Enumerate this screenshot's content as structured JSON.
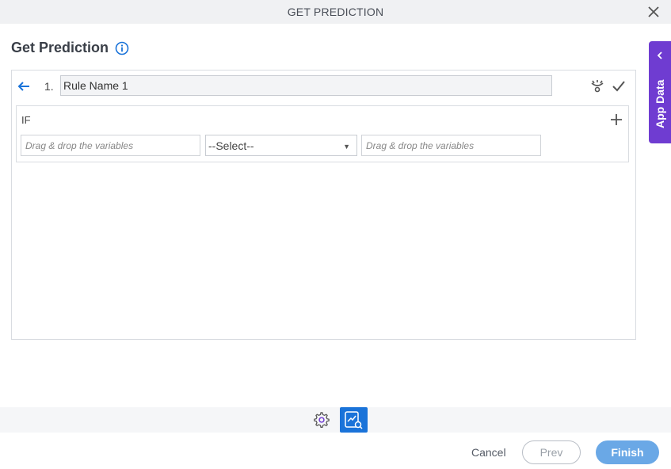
{
  "window": {
    "title": "GET PREDICTION",
    "close_icon": "close-icon"
  },
  "page": {
    "heading": "Get Prediction",
    "info_icon": "info-icon"
  },
  "rule": {
    "number": "1.",
    "name_value": "Rule Name 1",
    "icons": [
      "back-arrow-icon",
      "eye-toggle-icon",
      "check-icon"
    ]
  },
  "condition": {
    "label": "IF",
    "left_placeholder": "Drag & drop the variables",
    "operator_selected": "--Select--",
    "right_placeholder": "Drag & drop the variables",
    "add_icon": "plus-icon"
  },
  "side_panel": {
    "label": "App Data",
    "icon": "chevron-left-icon",
    "color": "#6f3cd1"
  },
  "toolbar": {
    "icons": [
      "gear-icon",
      "prediction-icon"
    ],
    "active_color": "#1a73d9"
  },
  "footer": {
    "cancel_label": "Cancel",
    "prev_label": "Prev",
    "finish_label": "Finish"
  }
}
